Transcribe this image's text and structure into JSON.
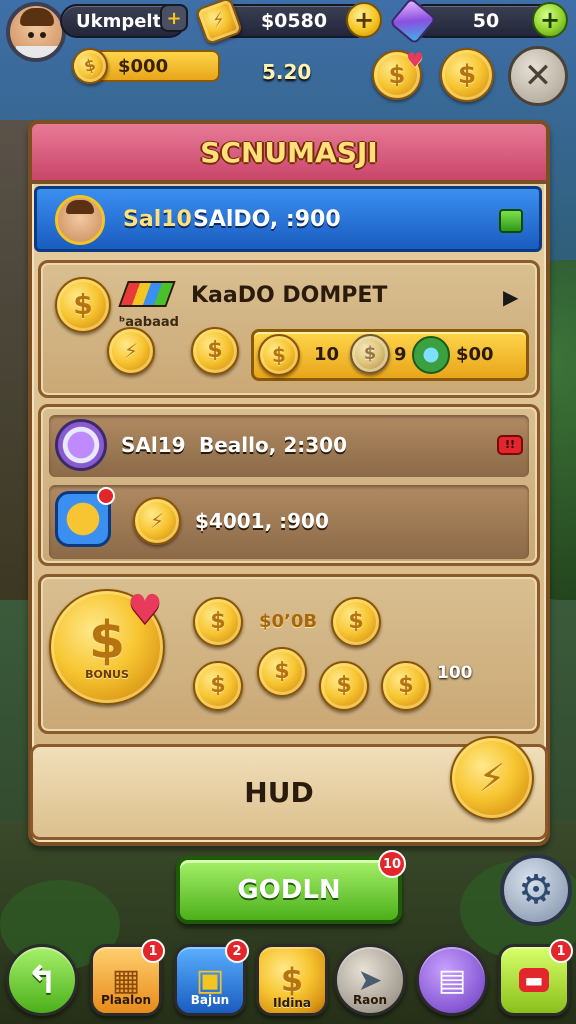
{
  "top_bar": {
    "player_name": "Ukmpelt",
    "gold_value": "$0580",
    "gems_value": "50",
    "plus_symbol": "+"
  },
  "secondary_bar": {
    "coin_balance": "$000",
    "center_value": "5.20",
    "close_symbol": "✕"
  },
  "panel": {
    "title": "SCNUMASJI",
    "header_row": {
      "prefix": "Sal10",
      "text": "SAlDO, ꞉900"
    },
    "section1": {
      "title": "KaaDO DOMPET",
      "subtitle": "ᵇaabaad",
      "bar_values": [
        "10",
        "9",
        "$00"
      ],
      "arrow": "▶"
    },
    "section2": {
      "row1_prefix": "SAl19",
      "row1_text": "Beallo, 2꞉300",
      "row2_text": "$4001, ꞉900",
      "badge_label": "!!"
    },
    "section3": {
      "big_coin_label": "BONUS",
      "coins_label": "$0ʼ0B",
      "side_value": "100"
    },
    "hud_label": "HUD"
  },
  "main_button": {
    "label": "GODLN",
    "badge": "10"
  },
  "bottom_nav": [
    {
      "label": "",
      "badge": ""
    },
    {
      "label": "Plaalon",
      "badge": "1"
    },
    {
      "label": "Bajun",
      "badge": "2"
    },
    {
      "label": "Ildina",
      "badge": ""
    },
    {
      "label": "Raon",
      "badge": ""
    },
    {
      "label": "",
      "badge": ""
    },
    {
      "label": "",
      "badge": "1"
    }
  ],
  "icons": {
    "currency": "dollar-coin-icon",
    "settings": "gear-icon",
    "back": "back-arrow-icon",
    "gem": "gem-icon",
    "close": "close-icon"
  },
  "colors": {
    "gold": "#f7c531",
    "blue_header": "#1f6fd6",
    "green_button": "#6cd02a",
    "panel_title_bg": "#d95a7a",
    "panel_bg": "#e6cfa4"
  }
}
